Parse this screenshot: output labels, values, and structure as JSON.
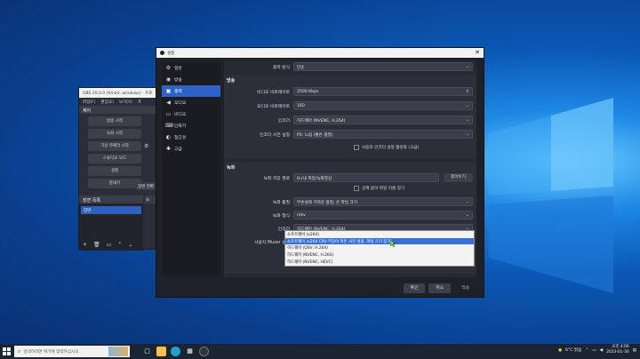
{
  "obs_main": {
    "title": "OBS 29.0.0 (64-bit, windows) - 프로",
    "menu": [
      "파일(F)",
      "편집(E)",
      "보기(V)",
      "프"
    ],
    "controls_header": "제어",
    "buttons": [
      "방송 시작",
      "녹화 시작",
      "가상 카메라 시작",
      "스튜디오 모드",
      "설정",
      "끝내기"
    ],
    "scenes_header": "장면 목록",
    "scene_item": "장면",
    "sources_header": "소",
    "transition_header": "장면 전환 효"
  },
  "settings": {
    "title": "설정",
    "sidebar": [
      {
        "label": "일반",
        "icon": "gear-icon"
      },
      {
        "label": "방송",
        "icon": "broadcast-icon"
      },
      {
        "label": "출력",
        "icon": "output-icon",
        "active": true
      },
      {
        "label": "오디오",
        "icon": "speaker-icon"
      },
      {
        "label": "비디오",
        "icon": "monitor-icon"
      },
      {
        "label": "단축키",
        "icon": "keyboard-icon"
      },
      {
        "label": "접근성",
        "icon": "accessibility-icon"
      },
      {
        "label": "고급",
        "icon": "tools-icon"
      }
    ],
    "output_mode_label": "출력 방식",
    "output_mode_value": "단순",
    "streaming": {
      "header": "방송",
      "video_bitrate_label": "비디오 비트레이트",
      "video_bitrate_value": "2500 Kbps",
      "audio_bitrate_label": "오디오 비트레이트",
      "audio_bitrate_value": "160",
      "encoder_label": "인코더",
      "encoder_value": "하드웨어 (NVENC, H.264)",
      "preset_label": "인코더 사전 설정",
      "preset_value": "P5: 느림 (좋은 품질)",
      "advanced_check": "사용자 인코더 설정 활성화 (고급)"
    },
    "recording": {
      "header": "녹화",
      "path_label": "녹화 저장 경로",
      "path_value": "D:/내 파일/녹화영상",
      "browse": "찾아보기",
      "nospace_check": "공백 없이 파일 이름 짓기",
      "quality_label": "녹화 품질",
      "quality_value": "무손실에 가까운 품질, 큰 파일 크기",
      "format_label": "녹화 형식",
      "format_value": "mkv",
      "encoder_label": "인코더",
      "encoder_value": "하드웨어 (NVENC, H.264)",
      "muxer_label": "사용자 Muxer 설정"
    },
    "dropdown_options": [
      "소프트웨어 (x264)",
      "소프트웨어 (x264 CPU 부담이 적은 사전 설정, 파일 크기 증가)",
      "하드웨어 (QSV, H.264)",
      "하드웨어 (NVENC, H.264)",
      "하드웨어 (NVENC, HEVC)"
    ],
    "highlighted_option_index": 1,
    "ok": "확인",
    "cancel": "취소",
    "apply": "적용"
  },
  "taskbar": {
    "search_placeholder": "검색하려면 여기에 입력하십시오.",
    "weather": "6°C 맑음",
    "time": "오후 4:06",
    "date": "2023-01-30"
  },
  "colors": {
    "accent": "#2e62c6",
    "window_bg": "#1f2128",
    "content_bg": "#272a33"
  }
}
